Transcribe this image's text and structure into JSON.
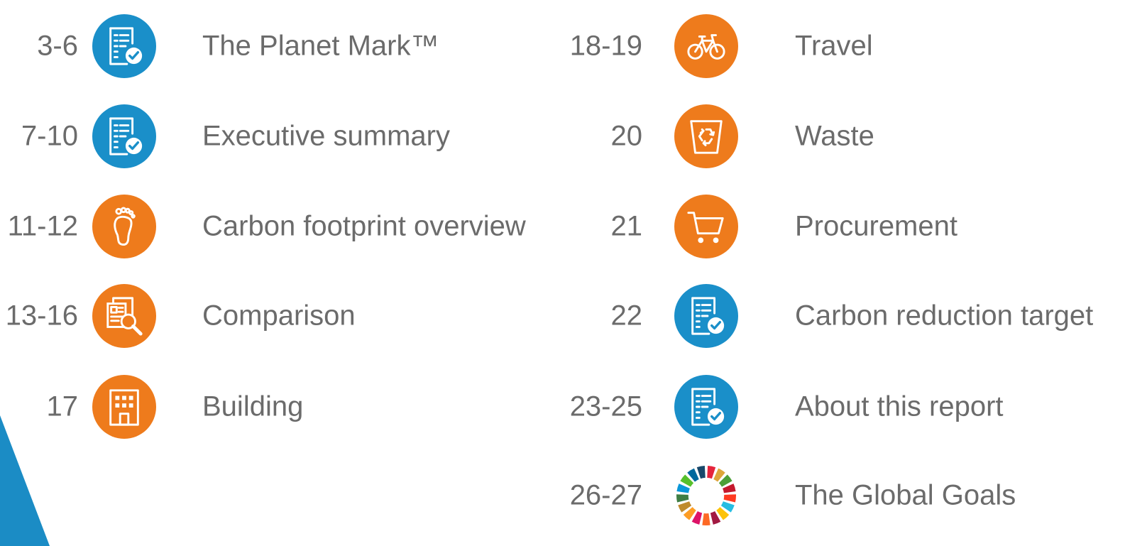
{
  "colors": {
    "blue": "#1a8fc9",
    "orange": "#ee7b1c",
    "text": "#6b6b6b",
    "wedge": "#1b8cc5"
  },
  "left": [
    {
      "pages": "3-6",
      "title": "The Planet Mark™",
      "icon": "report-check-icon",
      "color": "blue"
    },
    {
      "pages": "7-10",
      "title": "Executive summary",
      "icon": "report-check-icon",
      "color": "blue"
    },
    {
      "pages": "11-12",
      "title": "Carbon footprint overview",
      "icon": "footprint-icon",
      "color": "orange"
    },
    {
      "pages": "13-16",
      "title": "Comparison",
      "icon": "document-search-icon",
      "color": "orange"
    },
    {
      "pages": "17",
      "title": "Building",
      "icon": "building-icon",
      "color": "orange"
    }
  ],
  "right": [
    {
      "pages": "18-19",
      "title": "Travel",
      "icon": "bicycle-icon",
      "color": "orange"
    },
    {
      "pages": "20",
      "title": "Waste",
      "icon": "recycle-bin-icon",
      "color": "orange"
    },
    {
      "pages": "21",
      "title": "Procurement",
      "icon": "shopping-cart-icon",
      "color": "orange"
    },
    {
      "pages": "22",
      "title": "Carbon reduction target",
      "icon": "report-check-icon",
      "color": "blue"
    },
    {
      "pages": "23-25",
      "title": "About this report",
      "icon": "report-check-icon",
      "color": "blue"
    },
    {
      "pages": "26-27",
      "title": "The Global Goals",
      "icon": "sdg-wheel-icon",
      "color": "wheel"
    }
  ]
}
